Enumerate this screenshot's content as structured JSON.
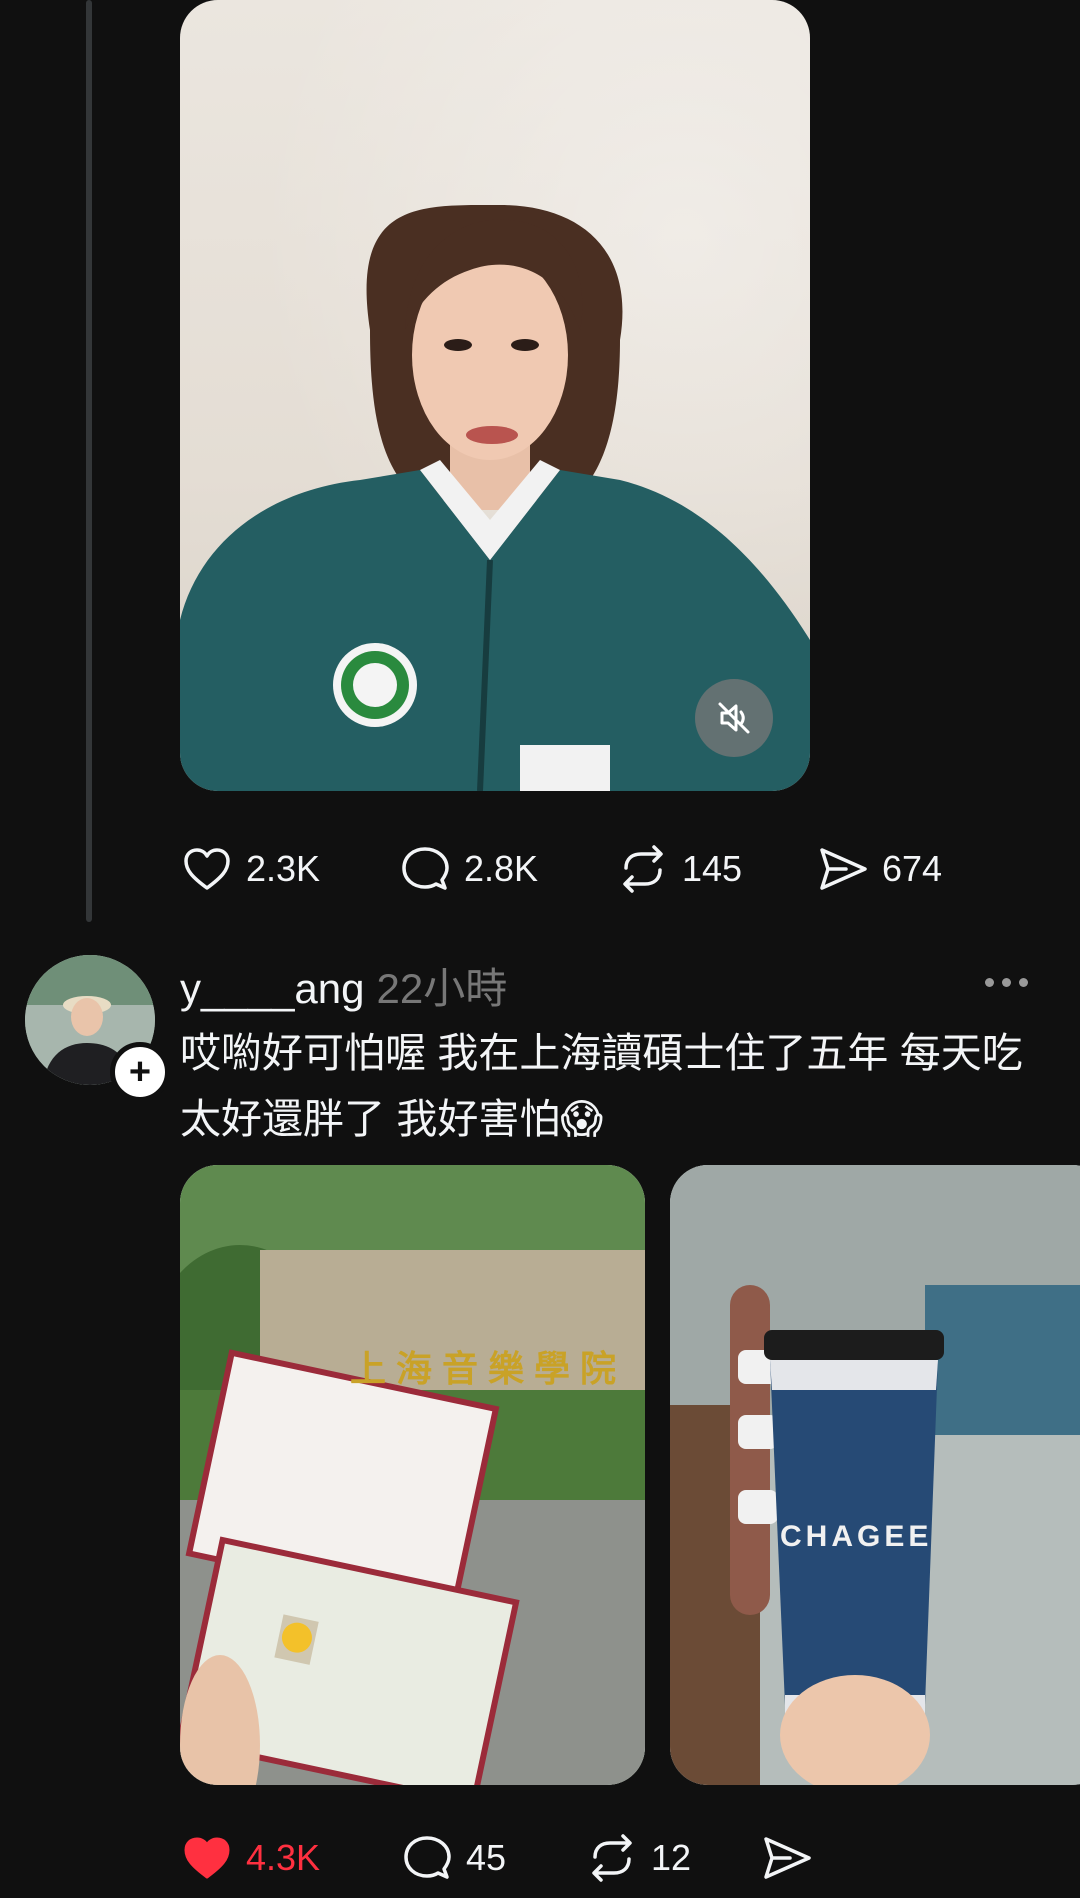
{
  "first_post": {
    "likes": "2.3K",
    "replies": "2.8K",
    "reposts": "145",
    "shares": "674",
    "media_icon": "mute-icon"
  },
  "second_post": {
    "username": "y____ang",
    "timestamp": "22小時",
    "text": "哎喲好可怕喔 我在上海讀碩士住了五年 每天吃太好還胖了 我好害怕😱",
    "photo1_sign_text": "上海音樂學院",
    "photo2_cup_brand": "CHAGEE",
    "likes": "4.3K",
    "replies": "45",
    "reposts": "12",
    "liked": true
  },
  "colors": {
    "background": "#101010",
    "text": "#f3f5f7",
    "muted": "#777777",
    "like_active": "#ff3040",
    "thread_line": "#333638"
  }
}
